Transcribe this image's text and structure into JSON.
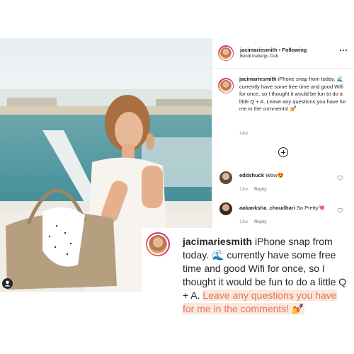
{
  "post": {
    "username": "jacimariesmith",
    "separator": "•",
    "follow_status": "Following",
    "location": "Bondi Icebergs Club",
    "caption_prefix": "iPhone snap from today. ",
    "caption_wave": "🌊",
    "caption_main": " currently have some free time and good Wifi for once, so I thought it would be fun to do a little Q + A. ",
    "caption_highlight": "Leave any questions you have for me in the comments! ",
    "caption_emoji": "💅",
    "time_ago": "14w"
  },
  "comments": [
    {
      "username": "eddshuck",
      "text": "Wow😍",
      "time": "13w",
      "reply_label": "Reply"
    },
    {
      "username": "aakanksha_choudhari",
      "text": "So Pretty💘",
      "time": "13w",
      "reply_label": "Reply"
    }
  ],
  "icons": {
    "more": "more-options-icon",
    "load_more": "plus-circle-icon",
    "like": "heart-icon",
    "user": "user-tag-icon"
  },
  "colors": {
    "highlight_bg": "#fbe7dc",
    "highlight_text": "#e0785a",
    "ring_gradient": [
      "#f9a13b",
      "#e1306c",
      "#c13584"
    ]
  }
}
